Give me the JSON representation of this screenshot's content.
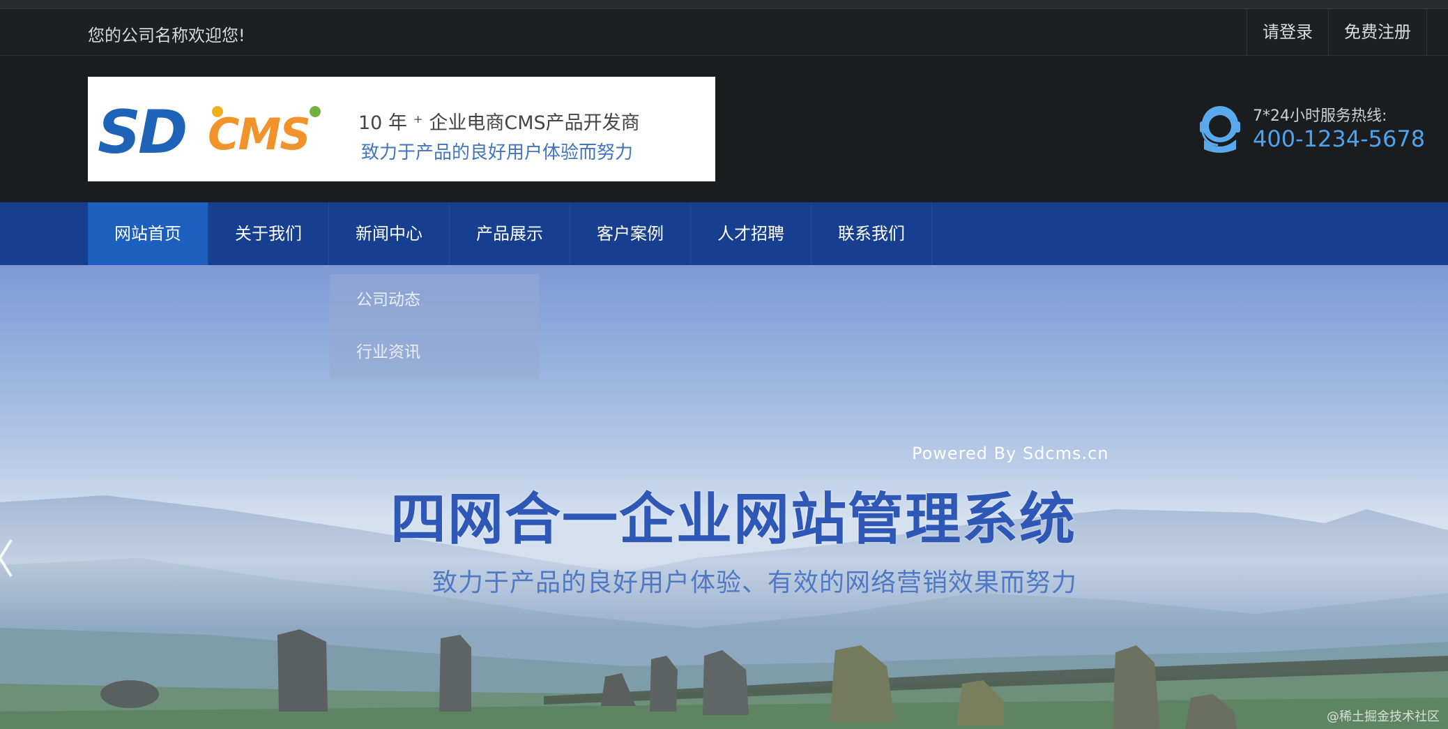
{
  "topbar": {
    "welcome": "您的公司名称欢迎您!",
    "login": "请登录",
    "register": "免费注册"
  },
  "header": {
    "logo_sd": "SD",
    "logo_cms": "CMS",
    "tagline_line1": "10 年 ⁺ 企业电商CMS产品开发商",
    "tagline_line2": "致力于产品的良好用户体验而努力",
    "hotline_label": "7*24小时服务热线:",
    "hotline_number": "400-1234-5678",
    "hotline_icon": "customer-service-icon"
  },
  "nav": {
    "items": [
      "网站首页",
      "关于我们",
      "新闻中心",
      "产品展示",
      "客户案例",
      "人才招聘",
      "联系我们"
    ],
    "active_index": 0
  },
  "dropdown": {
    "items": [
      "公司动态",
      "行业资讯"
    ]
  },
  "banner": {
    "powered": "Powered By Sdcms.cn",
    "headline": "四网合一企业网站管理系统",
    "subline": "致力于产品的良好用户体验、有效的网络营销效果而努力"
  },
  "watermark": "@稀土掘金技术社区",
  "colors": {
    "nav_bg": "#173f8f",
    "nav_active": "#1d5fbf",
    "hotline": "#4da3ee",
    "headline": "#2f58b6"
  }
}
